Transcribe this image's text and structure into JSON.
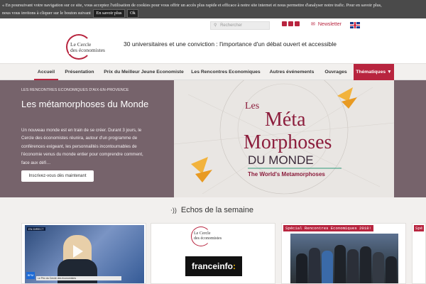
{
  "cookie": {
    "line1": "« En poursuivant votre navigation sur ce site, vous acceptez l'utilisation de cookies pour vous offrir un accès plus rapide et efficace à notre site internet et nous permettre d'analyser notre trafic. Pour en savoir plus,",
    "line2": "nous vous invitons à cliquer sur le bouton suivant",
    "more_label": "En savoir plus",
    "ok_label": "Ok"
  },
  "header": {
    "search_placeholder": "Rechercher",
    "newsletter_label": "Newsletter",
    "tagline": "30 universitaires et une conviction : l'importance d'un débat ouvert et accessible",
    "logo_text_1": "Le Cercle",
    "logo_text_2": "des économistes"
  },
  "nav": {
    "items": [
      "Accueil",
      "Présentation",
      "Prix du Meilleur Jeune Economiste",
      "Les Rencontres Economiques",
      "Autres événements",
      "Ouvrages",
      "Thématiques ▼"
    ]
  },
  "hero": {
    "kicker": "LES RENCONTRES ECONOMIQUES D'AIX-EN-PROVENCE",
    "title": "Les métamorphoses du Monde",
    "body": "Un nouveau monde est en train de se créer. Durant 3 jours, le Cercle des économistes réunira, autour d'un programme de conférences exigeant, les personnalités incontournables de l'économie venus du monde entier pour comprendre comment, face aux défi…",
    "cta_label": "Inscrivez-vous dès maintenant",
    "image_text": {
      "les": "Les",
      "meta": "Méta",
      "morphoses": "Morphoses",
      "du_monde": "DU MONDE",
      "worlds": "The World's Metamorphoses"
    }
  },
  "echos": {
    "title": "Echos de la semaine",
    "card1": {
      "live": "EN DIRECT",
      "chip": "BFM",
      "lower": "Le Prix du Cercle des économistes"
    },
    "card2": {
      "logo_text_1": "Le Cercle",
      "logo_text_2": "des économistes",
      "brand": "franceinfo",
      "brand_colon": ":"
    },
    "card3": {
      "badge": "Spécial Rencontres Economiques 2018!"
    },
    "card4": {
      "badge": "Spé"
    }
  },
  "colors": {
    "accent": "#b8253f",
    "hero_bg": "#76636b",
    "nav_bg": "#f2f0ee"
  },
  "icons": [
    "search-icon",
    "youtube-icon",
    "facebook-icon",
    "twitter-icon",
    "envelope-icon",
    "uk-flag-icon",
    "rss-icon",
    "play-icon",
    "origami-bird-icon"
  ]
}
